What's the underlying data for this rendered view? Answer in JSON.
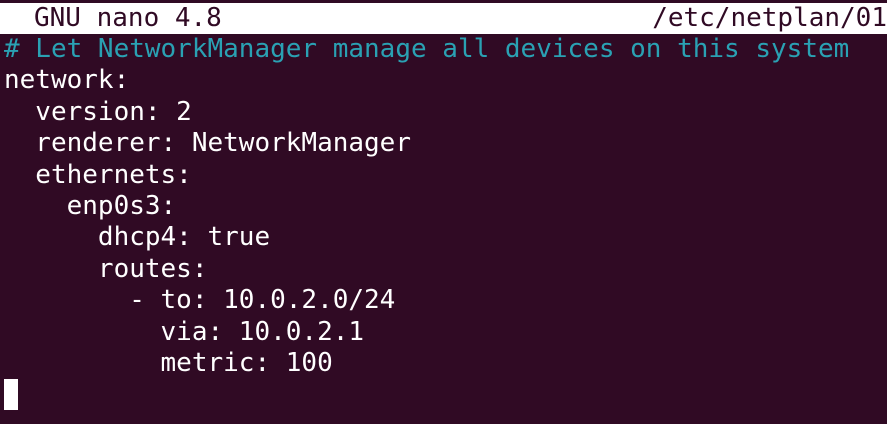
{
  "titlebar": {
    "app": "GNU nano 4.8",
    "filename": "/etc/netplan/01"
  },
  "editor": {
    "lines": [
      "# Let NetworkManager manage all devices on this system",
      "network:",
      "  version: 2",
      "  renderer: NetworkManager",
      "  ethernets:",
      "    enp0s3:",
      "      dhcp4: true",
      "      routes:",
      "        - to: 10.0.2.0/24",
      "          via: 10.0.2.1",
      "          metric: 100"
    ]
  },
  "colors": {
    "background": "#300a24",
    "foreground": "#ffffff",
    "comment": "#2aa1b3"
  }
}
